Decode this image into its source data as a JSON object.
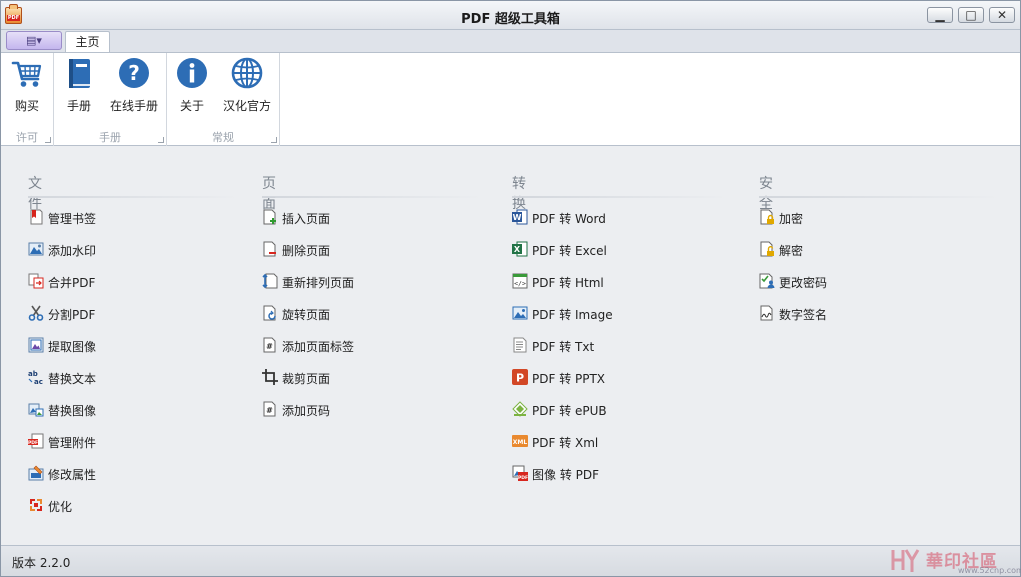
{
  "window": {
    "title": "PDF 超级工具箱",
    "buttons": {
      "minimize": "▁",
      "maximize": "□",
      "close": "✕"
    }
  },
  "app_menu": {
    "label": "▤▾"
  },
  "tabs": [
    {
      "label": "主页",
      "selected": true
    }
  ],
  "ribbon": {
    "groups": [
      {
        "label": "许可",
        "buttons": [
          {
            "label": "购买",
            "icon": "cart-icon"
          }
        ]
      },
      {
        "label": "手册",
        "buttons": [
          {
            "label": "手册",
            "icon": "book-icon"
          },
          {
            "label": "在线手册",
            "icon": "help-icon"
          }
        ]
      },
      {
        "label": "常规",
        "buttons": [
          {
            "label": "关于",
            "icon": "info-icon"
          },
          {
            "label": "汉化官方",
            "icon": "globe-icon"
          }
        ]
      }
    ]
  },
  "sections": [
    {
      "title": "文件",
      "items": [
        {
          "label": "管理书签",
          "icon": "bookmark-icon"
        },
        {
          "label": "添加水印",
          "icon": "watermark-icon"
        },
        {
          "label": "合并PDF",
          "icon": "merge-icon"
        },
        {
          "label": "分割PDF",
          "icon": "scissors-icon"
        },
        {
          "label": "提取图像",
          "icon": "extract-image-icon"
        },
        {
          "label": "替换文本",
          "icon": "replace-text-icon"
        },
        {
          "label": "替换图像",
          "icon": "replace-image-icon"
        },
        {
          "label": "管理附件",
          "icon": "attachment-icon"
        },
        {
          "label": "修改属性",
          "icon": "properties-icon"
        },
        {
          "label": "优化",
          "icon": "optimize-icon"
        }
      ]
    },
    {
      "title": "页面",
      "items": [
        {
          "label": "插入页面",
          "icon": "insert-page-icon"
        },
        {
          "label": "删除页面",
          "icon": "delete-page-icon"
        },
        {
          "label": "重新排列页面",
          "icon": "reorder-pages-icon"
        },
        {
          "label": "旋转页面",
          "icon": "rotate-page-icon"
        },
        {
          "label": "添加页面标签",
          "icon": "page-label-icon"
        },
        {
          "label": "裁剪页面",
          "icon": "crop-icon"
        },
        {
          "label": "添加页码",
          "icon": "page-number-icon"
        }
      ]
    },
    {
      "title": "转换",
      "items": [
        {
          "label": "PDF 转 Word",
          "icon": "word-icon"
        },
        {
          "label": "PDF 转 Excel",
          "icon": "excel-icon"
        },
        {
          "label": "PDF 转 Html",
          "icon": "html-icon"
        },
        {
          "label": "PDF 转 Image",
          "icon": "image-icon"
        },
        {
          "label": "PDF 转 Txt",
          "icon": "txt-icon"
        },
        {
          "label": "PDF 转 PPTX",
          "icon": "pptx-icon"
        },
        {
          "label": "PDF 转 ePUB",
          "icon": "epub-icon"
        },
        {
          "label": "PDF 转 Xml",
          "icon": "xml-icon"
        },
        {
          "label": "图像 转 PDF",
          "icon": "image-to-pdf-icon"
        }
      ]
    },
    {
      "title": "安全",
      "items": [
        {
          "label": "加密",
          "icon": "encrypt-icon"
        },
        {
          "label": "解密",
          "icon": "decrypt-icon"
        },
        {
          "label": "更改密码",
          "icon": "change-password-icon"
        },
        {
          "label": "数字签名",
          "icon": "digital-signature-icon"
        }
      ]
    }
  ],
  "status": {
    "version": "版本 2.2.0"
  },
  "watermark": {
    "text": "華印社區",
    "url": "www.52cnp.com"
  },
  "colors": {
    "accent_blue": "#2d6db5",
    "section_title": "#7d858f",
    "background": "#eceef1",
    "ribbon": "#ffffff"
  }
}
